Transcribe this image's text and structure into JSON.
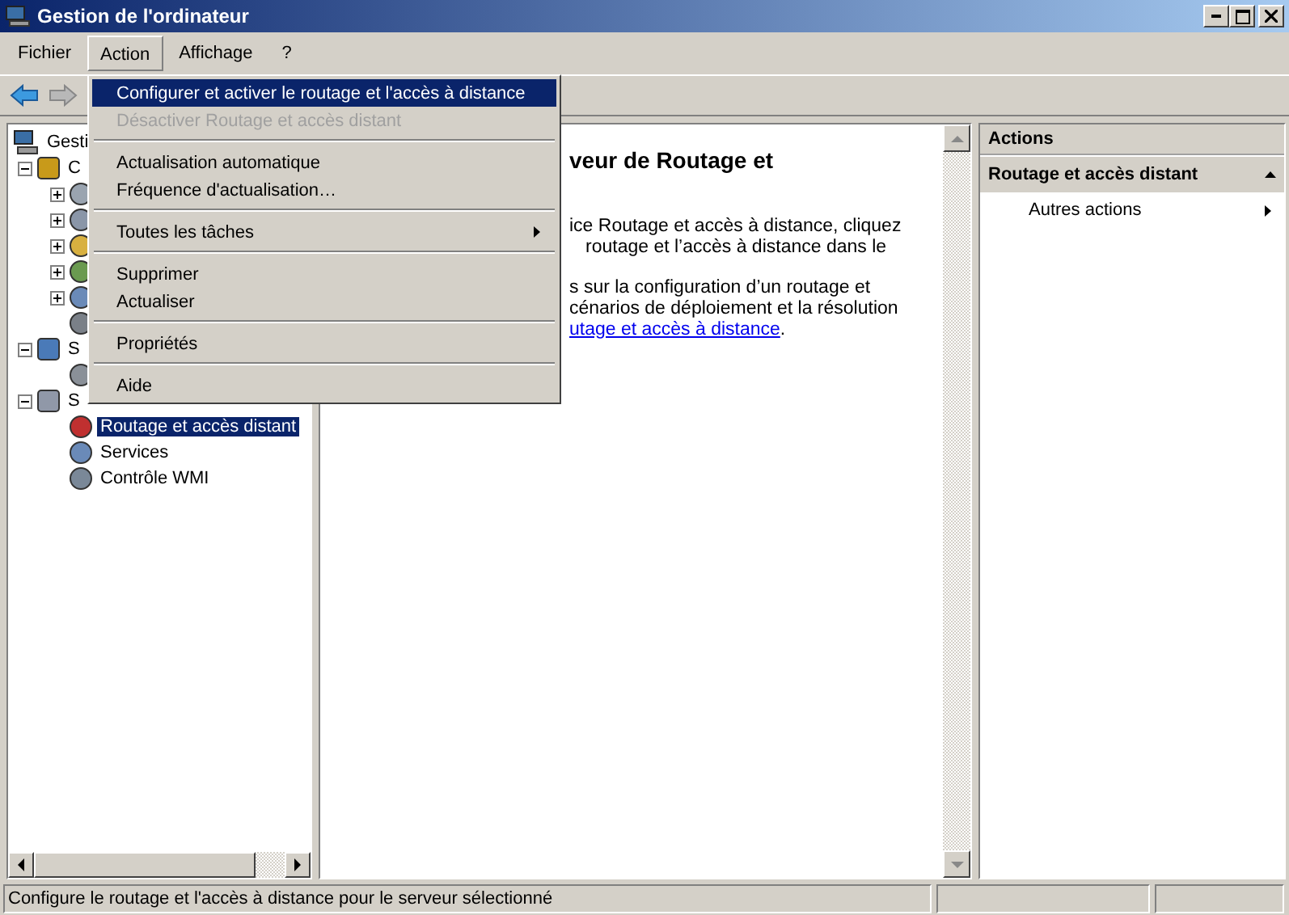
{
  "window": {
    "title": "Gestion de l'ordinateur"
  },
  "menu_bar": [
    {
      "label": "Fichier",
      "selected": false
    },
    {
      "label": "Action",
      "selected": true
    },
    {
      "label": "Affichage",
      "selected": false
    },
    {
      "label": "?",
      "selected": false
    }
  ],
  "tree": [
    {
      "label": "Gesti",
      "kind": "computer",
      "children": [
        {
          "label": "C",
          "kind": "tools",
          "expanded": true,
          "children": [
            {
              "kind": "clock",
              "expanded": false
            },
            {
              "kind": "log",
              "expanded": false
            },
            {
              "kind": "folder",
              "expanded": false
            },
            {
              "kind": "users",
              "expanded": false
            },
            {
              "kind": "gear",
              "expanded": false
            },
            {
              "kind": "device"
            }
          ]
        },
        {
          "label": "S",
          "kind": "storage",
          "expanded": true,
          "children": [
            {
              "kind": "disk"
            }
          ]
        },
        {
          "label": "S",
          "kind": "server",
          "expanded": true,
          "children": [
            {
              "label": "Routage et accès distant",
              "kind": "routing",
              "selected": true
            },
            {
              "label": "Services",
              "kind": "gear",
              "selected": false
            },
            {
              "label": "Contrôle WMI",
              "kind": "wmi",
              "selected": false
            }
          ]
        }
      ]
    }
  ],
  "content": {
    "heading": "veur de Routage et",
    "paragraphs": [
      [
        "ice Routage et accès à distance, cliquez",
        "routage et l’accès à distance dans le"
      ],
      [
        "s sur la configuration d’un routage et",
        "cénarios de déploiement et la résolution"
      ]
    ],
    "link": "utage et accès à distance",
    "link_tail": "."
  },
  "actions": {
    "title": "Actions",
    "section": "Routage et accès distant",
    "items": [
      "Autres actions"
    ]
  },
  "action_menu": [
    {
      "kind": "item",
      "label": "Configurer et activer le routage et l'accès à distance",
      "selected": true,
      "disabled": false
    },
    {
      "kind": "item",
      "label": "Désactiver Routage et accès distant",
      "selected": false,
      "disabled": true
    },
    {
      "kind": "separator"
    },
    {
      "kind": "item",
      "label": "Actualisation automatique",
      "selected": false,
      "disabled": false
    },
    {
      "kind": "item",
      "label": "Fréquence d'actualisation…",
      "selected": false,
      "disabled": false
    },
    {
      "kind": "separator"
    },
    {
      "kind": "item",
      "label": "Toutes les tâches",
      "selected": false,
      "disabled": false,
      "submenu": true
    },
    {
      "kind": "separator"
    },
    {
      "kind": "item",
      "label": "Supprimer",
      "selected": false,
      "disabled": false
    },
    {
      "kind": "item",
      "label": "Actualiser",
      "selected": false,
      "disabled": false
    },
    {
      "kind": "separator"
    },
    {
      "kind": "item",
      "label": "Propriétés",
      "selected": false,
      "disabled": false
    },
    {
      "kind": "separator"
    },
    {
      "kind": "item",
      "label": "Aide",
      "selected": false,
      "disabled": false
    }
  ],
  "status_bar": [
    "Configure le routage et l'accès à distance pour le serveur sélectionné"
  ]
}
